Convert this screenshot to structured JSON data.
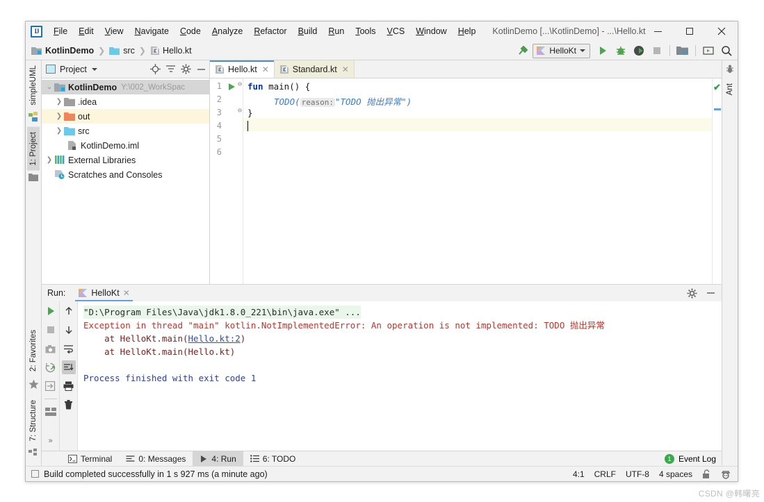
{
  "window": {
    "title": "KotlinDemo [...\\KotlinDemo] - ...\\Hello.kt",
    "logo_text": "IJ",
    "minimize": "—",
    "maximize": "□",
    "close": "✕"
  },
  "menu": [
    {
      "label": "File",
      "accel": "F"
    },
    {
      "label": "Edit",
      "accel": "E"
    },
    {
      "label": "View",
      "accel": "V"
    },
    {
      "label": "Navigate",
      "accel": "N"
    },
    {
      "label": "Code",
      "accel": "C"
    },
    {
      "label": "Analyze",
      "accel": "A"
    },
    {
      "label": "Refactor",
      "accel": "R"
    },
    {
      "label": "Build",
      "accel": "B"
    },
    {
      "label": "Run",
      "accel": "R"
    },
    {
      "label": "Tools",
      "accel": "T"
    },
    {
      "label": "VCS",
      "accel": "V"
    },
    {
      "label": "Window",
      "accel": "W"
    },
    {
      "label": "Help",
      "accel": "H"
    }
  ],
  "breadcrumb": [
    {
      "label": "KotlinDemo",
      "icon": "module-icon"
    },
    {
      "label": "src",
      "icon": "folder-icon"
    },
    {
      "label": "Hello.kt",
      "icon": "kotlin-file-icon"
    }
  ],
  "toolbar": {
    "build_icon": "hammer-icon",
    "run_config": "HelloKt",
    "run_icon": "run-icon",
    "debug_icon": "debug-icon",
    "coverage_icon": "run-with-coverage-icon",
    "stop_icon": "stop-icon",
    "project_structure_icon": "project-structure-icon",
    "tool_window_icon": "tool-window-icon",
    "search_icon": "search-everywhere-icon"
  },
  "left_strip": [
    {
      "label": "simpleUML",
      "icon": "uml-icon",
      "active": false
    },
    {
      "label": "1: Project",
      "icon": "folder-icon",
      "active": true
    }
  ],
  "left_strip_bottom": [
    {
      "label": "2: Favorites",
      "icon": "star-icon",
      "active": false
    },
    {
      "label": "7: Structure",
      "icon": "structure-icon",
      "active": false
    }
  ],
  "right_strip": [
    {
      "label": "Ant",
      "icon": "ant-icon",
      "active": false
    }
  ],
  "project_panel": {
    "title": "Project",
    "dropdown_icon": "chevron-down-icon",
    "locate_icon": "locate-icon",
    "collapse_icon": "collapse-all-icon",
    "settings_icon": "gear-icon",
    "hide_icon": "hide-icon",
    "tree": [
      {
        "label": "KotlinDemo",
        "note": "Y:\\002_WorkSpac",
        "icon": "module-icon",
        "arrow": "expanded",
        "indent": 0,
        "bold": true,
        "state": "selected"
      },
      {
        "label": ".idea",
        "note": "",
        "icon": "folder-gray-icon",
        "arrow": "collapsed",
        "indent": 1,
        "bold": false,
        "state": "none"
      },
      {
        "label": "out",
        "note": "",
        "icon": "folder-orange-icon",
        "arrow": "collapsed",
        "indent": 1,
        "bold": false,
        "state": "hover"
      },
      {
        "label": "src",
        "note": "",
        "icon": "folder-blue-icon",
        "arrow": "collapsed",
        "indent": 1,
        "bold": false,
        "state": "none"
      },
      {
        "label": "KotlinDemo.iml",
        "note": "",
        "icon": "iml-file-icon",
        "arrow": "none",
        "indent": 1,
        "bold": false,
        "state": "none"
      },
      {
        "label": "External Libraries",
        "note": "",
        "icon": "libraries-icon",
        "arrow": "collapsed",
        "indent": 0,
        "bold": false,
        "state": "none"
      },
      {
        "label": "Scratches and Consoles",
        "note": "",
        "icon": "scratches-icon",
        "arrow": "none",
        "indent": 0,
        "bold": false,
        "state": "none"
      }
    ]
  },
  "editor": {
    "tabs": [
      {
        "label": "Hello.kt",
        "icon": "kotlin-file-icon",
        "active": true,
        "close": "✕"
      },
      {
        "label": "Standard.kt",
        "icon": "kotlin-file-icon",
        "active": false,
        "close": "✕"
      }
    ],
    "line_numbers": [
      "1",
      "2",
      "3",
      "4",
      "5",
      "6"
    ],
    "current_line": 4,
    "code": {
      "l1_kw": "fun",
      "l1_name": " main() {",
      "l2_call": "TODO(",
      "l2_inlay": "reason:",
      "l2_str": "\"TODO 抛出异常\")",
      "l3": "}"
    },
    "inspection_status": "✔",
    "gutter_run_icon": "run-icon"
  },
  "run_panel": {
    "label": "Run:",
    "tab": "HelloKt",
    "tab_icon": "kotlin-icon",
    "tab_close": "✕",
    "settings_icon": "gear-icon",
    "hide_icon": "hide-icon",
    "sidebar_icons_col1": [
      "rerun-icon",
      "stop-icon",
      "screenshot-icon",
      "rerun-failed-icon",
      "export-icon",
      "layout-icon",
      "expand-icon"
    ],
    "sidebar_icons_col2": [
      "up-icon",
      "down-icon",
      "soft-wrap-icon",
      "scroll-to-end-icon",
      "print-icon",
      "clear-all-icon"
    ],
    "console": [
      {
        "text": "\"D:\\Program Files\\Java\\jdk1.8.0_221\\bin\\java.exe\" ...",
        "style": "cmd"
      },
      {
        "text": "Exception in thread \"main\" kotlin.NotImplementedError: An operation is not implemented: TODO 抛出异常",
        "style": "err"
      },
      {
        "text": "    at HelloKt.main(",
        "link": "Hello.kt:2",
        "suffix": ")",
        "style": "trace"
      },
      {
        "text": "    at HelloKt.main(Hello.kt)",
        "style": "trace"
      },
      {
        "text": "",
        "style": "plain"
      },
      {
        "text": "Process finished with exit code 1",
        "style": "info"
      }
    ]
  },
  "bottom_bar": {
    "items": [
      {
        "label": "Terminal",
        "icon": "terminal-icon",
        "active": false
      },
      {
        "label": "0: Messages",
        "icon": "messages-icon",
        "active": false,
        "accel": "0"
      },
      {
        "label": "4: Run",
        "icon": "run-icon",
        "active": true,
        "accel": "4"
      },
      {
        "label": "6: TODO",
        "icon": "todo-icon",
        "active": false,
        "accel": "6"
      }
    ],
    "event_log": "Event Log",
    "event_badge": "1"
  },
  "status_bar": {
    "message": "Build completed successfully in 1 s 927 ms (a minute ago)",
    "message_icon": "build-icon",
    "caret_position": "4:1",
    "line_separator": "CRLF",
    "encoding": "UTF-8",
    "indent": "4 spaces",
    "lock_icon": "unlocked-icon",
    "inspector_icon": "inspector-icon"
  },
  "watermark": "CSDN @韩曙亮"
}
